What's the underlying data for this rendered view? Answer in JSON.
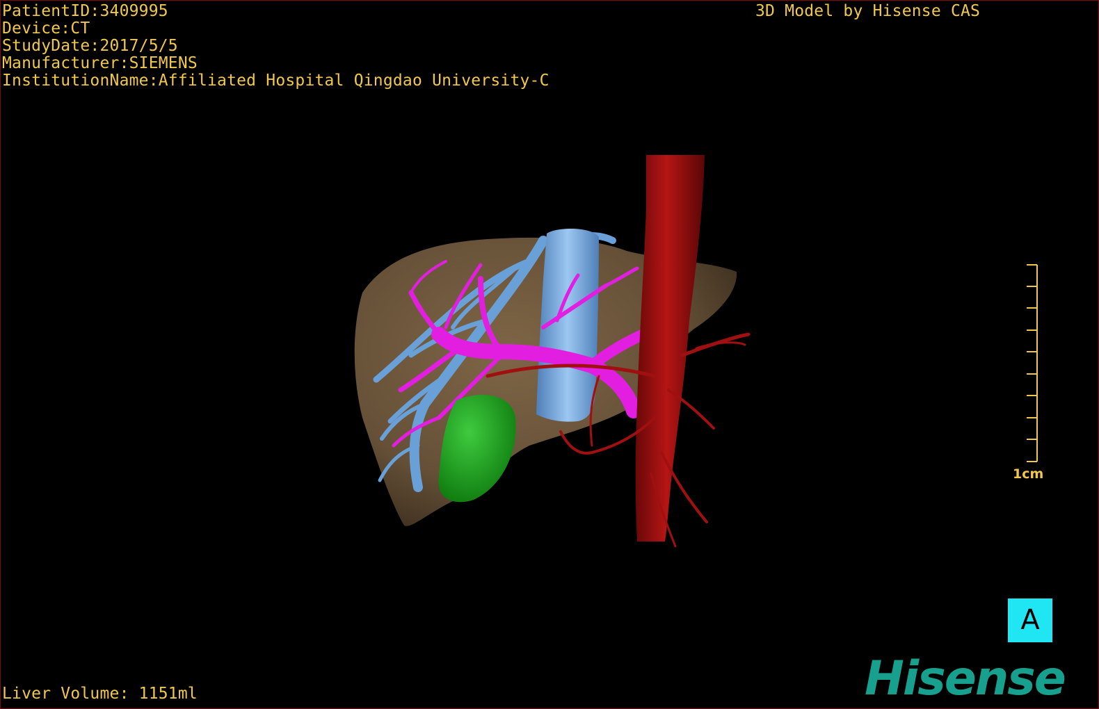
{
  "patient_info": {
    "patient_id": "PatientID:3409995",
    "device": "Device:CT",
    "study_date": "StudyDate:2017/5/5",
    "manufacturer": "Manufacturer:SIEMENS",
    "institution": "InstitutionName:Affiliated Hospital Qingdao University-C"
  },
  "model_credit": "3D Model by Hisense CAS",
  "liver_volume": "Liver Volume: 1151ml",
  "scale_bar": {
    "label": "1cm"
  },
  "orientation_marker": {
    "label": "A"
  },
  "brand_logo": "Hisense",
  "colors": {
    "overlay_text": "#f2c84b",
    "liver": "#7a6245",
    "portal_vein": "#e21fe0",
    "hepatic_vein": "#6aa0d8",
    "vena_cava": "#7fb2ea",
    "artery": "#a11010",
    "gallbladder": "#1da41d",
    "marker_background": "#20e6f3",
    "brand": "#16a08d"
  },
  "icons": {
    "orientation": "anterior-view-cube-icon",
    "scale": "ruler-scale-icon"
  }
}
